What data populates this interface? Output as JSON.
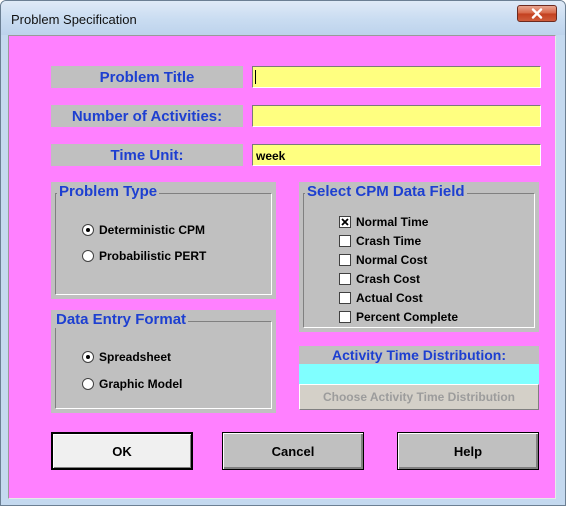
{
  "window": {
    "title": "Problem Specification"
  },
  "fields": {
    "problem_title": {
      "label": "Problem Title",
      "value": ""
    },
    "num_activities": {
      "label": "Number of Activities:",
      "value": ""
    },
    "time_unit": {
      "label": "Time Unit:",
      "value": "week"
    }
  },
  "problem_type": {
    "title": "Problem Type",
    "options": [
      {
        "label": "Deterministic CPM",
        "selected": true
      },
      {
        "label": "Probabilistic PERT",
        "selected": false
      }
    ]
  },
  "data_entry_format": {
    "title": "Data Entry Format",
    "options": [
      {
        "label": "Spreadsheet",
        "selected": true
      },
      {
        "label": "Graphic Model",
        "selected": false
      }
    ]
  },
  "cpm_data_field": {
    "title": "Select CPM Data Field",
    "options": [
      {
        "label": "Normal Time",
        "checked": true
      },
      {
        "label": "Crash Time",
        "checked": false
      },
      {
        "label": "Normal Cost",
        "checked": false
      },
      {
        "label": "Crash Cost",
        "checked": false
      },
      {
        "label": "Actual Cost",
        "checked": false
      },
      {
        "label": "Percent Complete",
        "checked": false
      }
    ]
  },
  "activity_time_distribution": {
    "label": "Activity Time Distribution:",
    "value": "",
    "button": "Choose Activity Time Distribution"
  },
  "buttons": {
    "ok": "OK",
    "cancel": "Cancel",
    "help": "Help"
  },
  "colors": {
    "background": "#ff80ff",
    "label_bg": "#c0c0c0",
    "label_text": "#1d3fd1",
    "input_bg": "#ffff80",
    "distribution_bg": "#80ffff"
  }
}
